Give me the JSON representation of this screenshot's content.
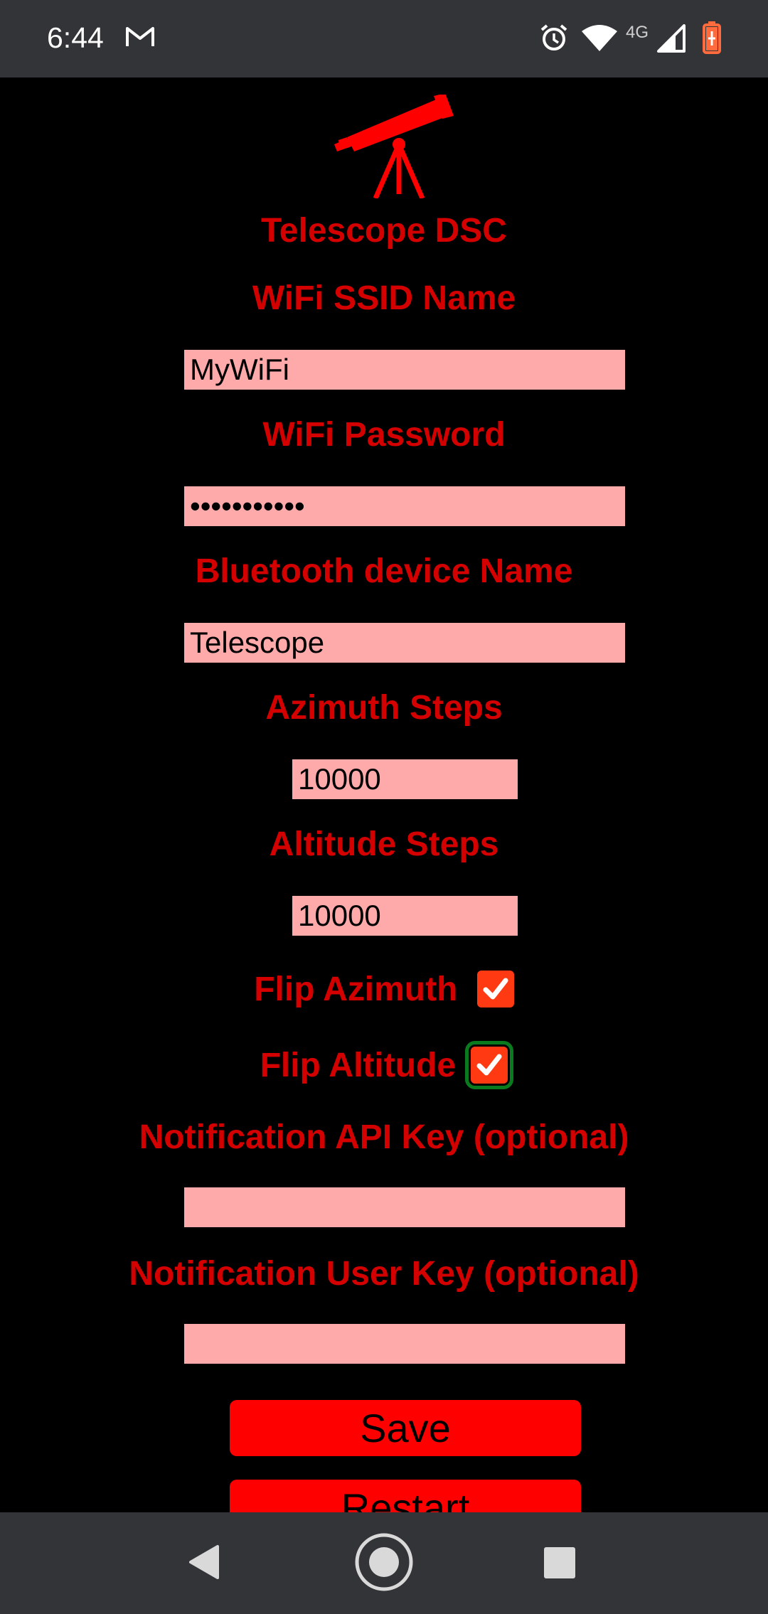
{
  "status_bar": {
    "time": "6:44",
    "network": "4G",
    "icons": [
      "gmail-icon",
      "alarm-icon",
      "wifi-icon",
      "cell-signal-icon",
      "battery-charging-icon"
    ]
  },
  "app": {
    "logo_icon": "telescope-icon",
    "title": "Telescope DSC",
    "wifi_ssid": {
      "label": "WiFi SSID Name",
      "value": "MyWiFi"
    },
    "wifi_password": {
      "label": "WiFi Password",
      "value": "•••••••••••"
    },
    "bluetooth_name": {
      "label": "Bluetooth device Name",
      "value": "Telescope"
    },
    "azimuth_steps": {
      "label": "Azimuth Steps",
      "value": "10000"
    },
    "altitude_steps": {
      "label": "Altitude Steps",
      "value": "10000"
    },
    "flip_azimuth": {
      "label": "Flip Azimuth",
      "checked": true
    },
    "flip_altitude": {
      "label": "Flip Altitude",
      "checked": true
    },
    "notification_api_key": {
      "label": "Notification API Key (optional)",
      "value": ""
    },
    "notification_user_key": {
      "label": "Notification User Key (optional)",
      "value": ""
    },
    "save_label": "Save",
    "restart_label": "Restart"
  },
  "colors": {
    "accent_red": "#d40000",
    "button_red": "#ff0000",
    "input_pink": "#ffaaaa",
    "checkbox_orange": "#ff3a12",
    "focus_green": "#0a7a1e"
  },
  "nav_bar": {
    "icons": [
      "back-icon",
      "home-icon",
      "recents-icon"
    ]
  }
}
